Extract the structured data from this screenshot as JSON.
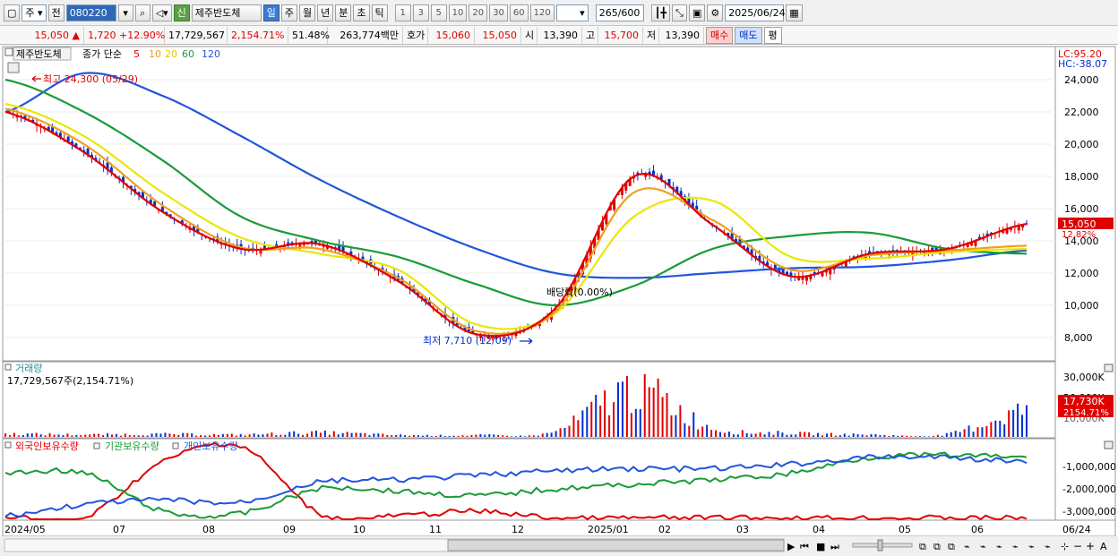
{
  "toolbar": {
    "period_type": "주",
    "prev": "전",
    "code": "080220",
    "badge": "신",
    "stock_name": "제주반도체",
    "period_tabs": [
      "일",
      "주",
      "월",
      "년",
      "분",
      "초",
      "틱"
    ],
    "active_tab": "일",
    "intervals": [
      "1",
      "3",
      "5",
      "10",
      "20",
      "30",
      "60",
      "120"
    ],
    "bar_count": "265",
    "bar_total": "/600",
    "date": "2025/06/24"
  },
  "info": {
    "price": "15,050",
    "change": "1,720",
    "change_pct": "+12.90%",
    "volume": "17,729,567",
    "volume_pct": "2,154.71%",
    "turnover_pct": "51.48%",
    "amount": "263,774백만",
    "ask_label": "호가",
    "ask_price": "15,060",
    "bid_price": "15,050",
    "open_label": "시",
    "open": "13,390",
    "high_label": "고",
    "high": "15,700",
    "low_label": "저",
    "low": "13,390",
    "buy": "매수",
    "sell": "매도",
    "flat": "평"
  },
  "price_panel": {
    "stock_label": "제주반도체",
    "ma_label": "종가 단순",
    "ma_periods": [
      {
        "period": "5",
        "color": "#e00000"
      },
      {
        "period": "10",
        "color": "#f0a020"
      },
      {
        "period": "20",
        "color": "#e8e800"
      },
      {
        "period": "60",
        "color": "#1a9a3a"
      },
      {
        "period": "120",
        "color": "#2255dd"
      }
    ],
    "lc": "LC:95.20",
    "hc": "HC:-38.07",
    "high_marker": "최고 24,300 (05/29)",
    "low_marker": "최저 7,710 (12/09)",
    "dividend": "배당락(0.00%)",
    "current_price": "15,050",
    "current_pct": "12.82%",
    "y_ticks": [
      "24,000",
      "22,000",
      "20,000",
      "18,000",
      "16,000",
      "14,000",
      "12,000",
      "10,000",
      "8,000"
    ]
  },
  "volume_panel": {
    "title": "거래량",
    "value": "17,729,567주(2,154.71%)",
    "y_ticks": [
      "30,000K",
      "20,000K"
    ],
    "current": "17,730K",
    "current_pct": "2154.71%",
    "hidden_tick": "10,000K"
  },
  "holdings_panel": {
    "series": [
      {
        "name": "외국인보유수량",
        "color": "#e00000"
      },
      {
        "name": "기관보유수량",
        "color": "#1a9a3a"
      },
      {
        "name": "개인보유수량",
        "color": "#2255dd"
      }
    ],
    "y_ticks": [
      "-1,000,000",
      "-2,000,000",
      "-3,000,000"
    ]
  },
  "x_axis": [
    "2024/05",
    "07",
    "08",
    "09",
    "10",
    "11",
    "12",
    "2025/01",
    "02",
    "03",
    "04",
    "05",
    "06"
  ],
  "x_axis_end": "06/24",
  "chart_data": [
    {
      "type": "line",
      "title": "제주반도체",
      "series": [
        {
          "name": "5",
          "color": "#e00000",
          "x": [
            "2024/05",
            "07",
            "08",
            "09",
            "10",
            "11",
            "12",
            "2025/01",
            "02",
            "03",
            "04",
            "05",
            "06",
            "06/24"
          ],
          "values": [
            22000,
            19500,
            15800,
            13500,
            13800,
            11500,
            8200,
            9800,
            18000,
            15000,
            11800,
            13200,
            13500,
            15050
          ]
        },
        {
          "name": "10",
          "color": "#f0a020",
          "x": [
            "2024/05",
            "07",
            "08",
            "09",
            "10",
            "11",
            "12",
            "2025/01",
            "02",
            "03",
            "04",
            "05",
            "06",
            "06/24"
          ],
          "values": [
            22200,
            20000,
            16200,
            13600,
            13500,
            11700,
            8400,
            9600,
            17000,
            15300,
            12200,
            13100,
            13400,
            13700
          ]
        },
        {
          "name": "20",
          "color": "#e8e800",
          "x": [
            "2024/05",
            "07",
            "08",
            "09",
            "10",
            "11",
            "12",
            "2025/01",
            "02",
            "03",
            "04",
            "05",
            "06",
            "06/24"
          ],
          "values": [
            22500,
            20500,
            17000,
            14200,
            13200,
            12200,
            8800,
            9500,
            15500,
            16500,
            13000,
            12900,
            13300,
            13500
          ]
        },
        {
          "name": "60",
          "color": "#1a9a3a",
          "x": [
            "2024/05",
            "07",
            "08",
            "09",
            "10",
            "11",
            "12",
            "2025/01",
            "02",
            "03",
            "04",
            "05",
            "06",
            "06/24"
          ],
          "values": [
            24000,
            22000,
            19000,
            15500,
            14000,
            13000,
            11300,
            10000,
            11200,
            13500,
            14300,
            14500,
            13500,
            13200
          ]
        },
        {
          "name": "120",
          "color": "#2255dd",
          "x": [
            "2024/05",
            "07",
            "08",
            "09",
            "10",
            "11",
            "12",
            "2025/01",
            "02",
            "03",
            "04",
            "05",
            "06",
            "06/24"
          ],
          "values": [
            22000,
            24400,
            23000,
            20500,
            17800,
            15500,
            13500,
            12000,
            11700,
            12000,
            12300,
            12400,
            12800,
            13400
          ]
        }
      ],
      "ylim": [
        7000,
        25000
      ]
    },
    {
      "type": "bar",
      "title": "거래량",
      "categories": [
        "2024/05",
        "07",
        "08",
        "09",
        "10",
        "11",
        "12",
        "2025/01",
        "02",
        "03",
        "04",
        "05",
        "06",
        "06/24"
      ],
      "values": [
        2000,
        1500,
        1800,
        1500,
        2800,
        1200,
        1200,
        3500,
        31000,
        6000,
        2500,
        1500,
        1800,
        17730
      ],
      "ylim": [
        0,
        35000
      ]
    },
    {
      "type": "line",
      "title": "보유수량",
      "series": [
        {
          "name": "외국인보유수량",
          "x": [
            "2024/05",
            "07",
            "08",
            "09",
            "10",
            "11",
            "12",
            "2025/01",
            "02",
            "03",
            "04",
            "05",
            "06",
            "06/24"
          ],
          "values": [
            -3200000,
            -3300000,
            -800000,
            -100000,
            -3100000,
            -3200000,
            -3000000,
            -3300000,
            -3300000,
            -3300000,
            -3300000,
            -3300000,
            -3300000,
            -3300000
          ]
        },
        {
          "name": "기관보유수량",
          "x": [
            "2024/05",
            "07",
            "08",
            "09",
            "10",
            "11",
            "12",
            "2025/01",
            "02",
            "03",
            "04",
            "05",
            "06",
            "06/24"
          ],
          "values": [
            -1300000,
            -1300000,
            -3000000,
            -3100000,
            -2000000,
            -2100000,
            -2300000,
            -2000000,
            -1800000,
            -1600000,
            -1300000,
            -600000,
            -500000,
            -600000
          ]
        },
        {
          "name": "개인보유수량",
          "x": [
            "2024/05",
            "07",
            "08",
            "09",
            "10",
            "11",
            "12",
            "2025/01",
            "02",
            "03",
            "04",
            "05",
            "06",
            "06/24"
          ],
          "values": [
            -3200000,
            -2700000,
            -2500000,
            -2600000,
            -1700000,
            -1600000,
            -1400000,
            -1200000,
            -1100000,
            -1100000,
            -900000,
            -600000,
            -600000,
            -800000
          ]
        }
      ],
      "ylim": [
        -3400000,
        0
      ]
    }
  ]
}
